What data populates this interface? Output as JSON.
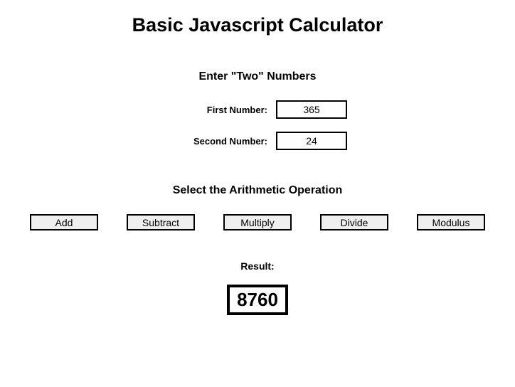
{
  "title": "Basic Javascript Calculator",
  "inputs_heading": "Enter \"Two\" Numbers",
  "first_number_label": "First Number:",
  "first_number_value": "365",
  "second_number_label": "Second Number:",
  "second_number_value": "24",
  "operation_heading": "Select the Arithmetic Operation",
  "buttons": {
    "add": "Add",
    "subtract": "Subtract",
    "multiply": "Multiply",
    "divide": "Divide",
    "modulus": "Modulus"
  },
  "result_label": "Result:",
  "result_value": "8760"
}
